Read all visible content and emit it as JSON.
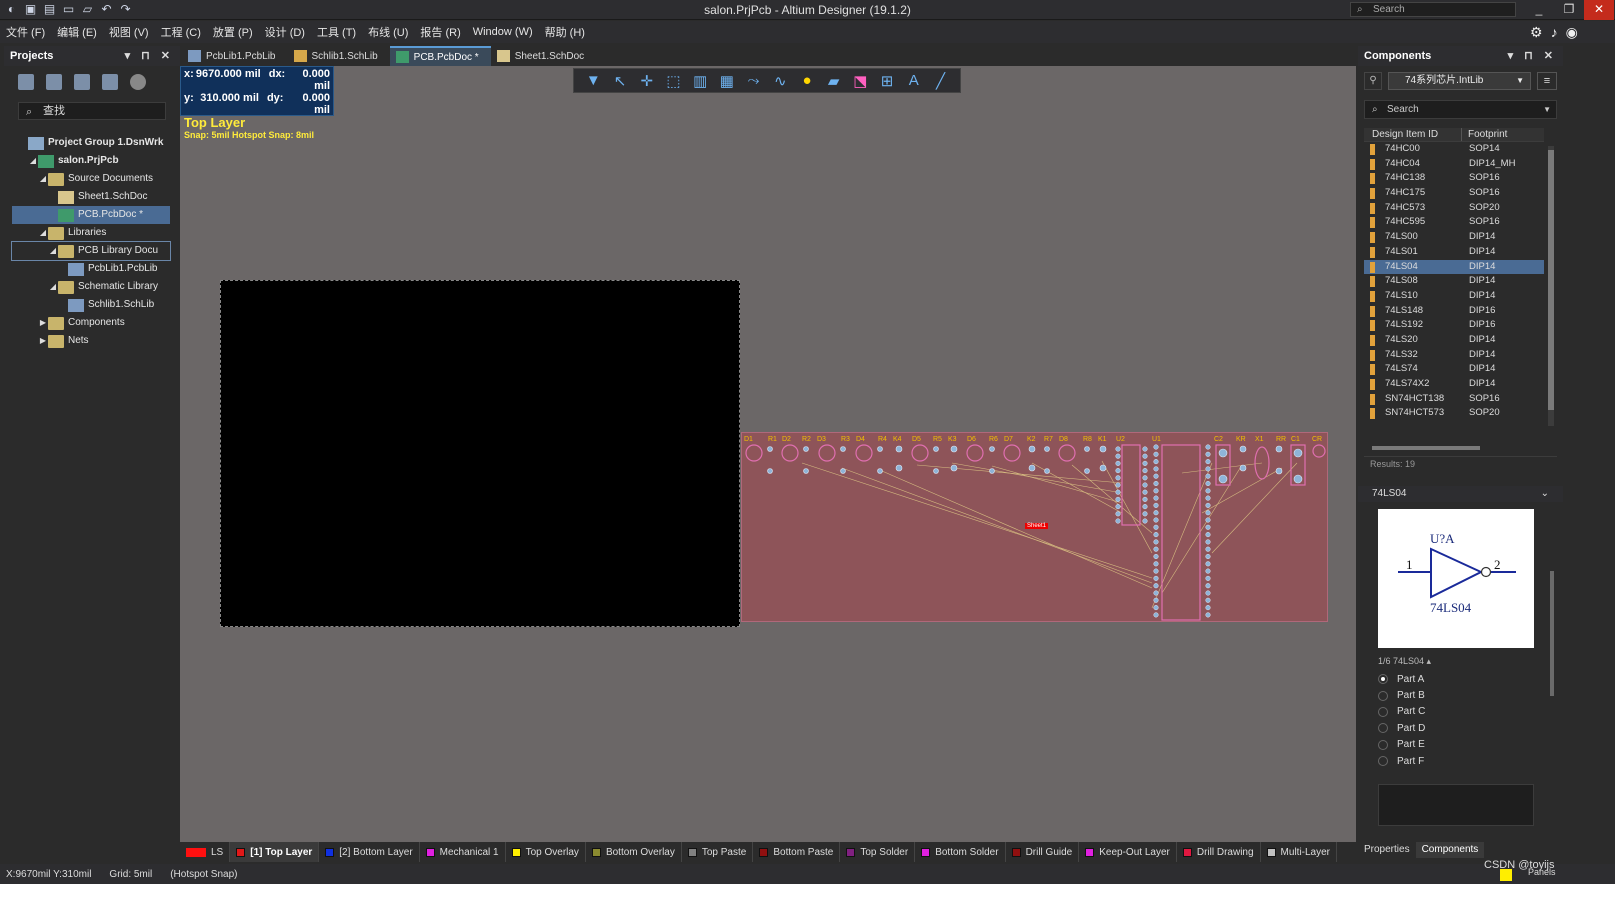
{
  "window": {
    "title": "salon.PrjPcb - Altium Designer (19.1.2)",
    "search_placeholder": "Search"
  },
  "menu": [
    "文件 (F)",
    "编辑 (E)",
    "视图 (V)",
    "工程 (C)",
    "放置 (P)",
    "设计 (D)",
    "工具 (T)",
    "布线 (U)",
    "报告 (R)",
    "Window (W)",
    "帮助 (H)"
  ],
  "projects": {
    "title": "Projects",
    "search_placeholder": "查找",
    "tree": [
      {
        "label": "Project Group 1.DsnWrk",
        "level": 0,
        "icon": "project-group-icon",
        "bold": true
      },
      {
        "label": "salon.PrjPcb",
        "level": 1,
        "icon": "project-icon",
        "bold": true
      },
      {
        "label": "Source Documents",
        "level": 2,
        "icon": "folder-icon"
      },
      {
        "label": "Sheet1.SchDoc",
        "level": 3,
        "icon": "schdoc-icon"
      },
      {
        "label": "PCB.PcbDoc *",
        "level": 3,
        "icon": "pcbdoc-icon",
        "selected": true
      },
      {
        "label": "Libraries",
        "level": 2,
        "icon": "folder-icon"
      },
      {
        "label": "PCB Library Docu",
        "level": 3,
        "icon": "folder-icon",
        "bordered": true
      },
      {
        "label": "PcbLib1.PcbLib",
        "level": 4,
        "icon": "pcblib-icon"
      },
      {
        "label": "Schematic Library",
        "level": 3,
        "icon": "folder-icon"
      },
      {
        "label": "Schlib1.SchLib",
        "level": 4,
        "icon": "schlib-icon"
      },
      {
        "label": "Components",
        "level": 2,
        "icon": "folder-icon",
        "collapsed": true
      },
      {
        "label": "Nets",
        "level": 2,
        "icon": "folder-icon",
        "collapsed": true
      }
    ]
  },
  "tabs": [
    {
      "label": "PcbLib1.PcbLib",
      "active": false,
      "color": "#7d9ac0"
    },
    {
      "label": "Schlib1.SchLib",
      "active": false,
      "color": "#d6a84a"
    },
    {
      "label": "PCB.PcbDoc *",
      "active": true,
      "color": "#3f9a6b"
    },
    {
      "label": "Sheet1.SchDoc",
      "active": false,
      "color": "#d8c68d"
    }
  ],
  "coords": {
    "x": "9670.000",
    "dx": "0.000 mil",
    "y": "310.000",
    "dy": "0.000 mil",
    "x_label": "x:",
    "y_label": "y:",
    "dx_label": "dx:",
    "dy_label": "dy:",
    "x_unit": "mil",
    "y_unit": "mil",
    "layer": "Top Layer",
    "snap": "Snap: 5mil Hotspot Snap: 8mil"
  },
  "pcb": {
    "sheet_label": "Sheet1"
  },
  "components": {
    "title": "Components",
    "library": "74系列芯片.IntLib",
    "search_placeholder": "Search",
    "col_id": "Design Item ID",
    "col_fp": "Footprint",
    "rows": [
      [
        "74HC00",
        "SOP14"
      ],
      [
        "74HC04",
        "DIP14_MH"
      ],
      [
        "74HC138",
        "SOP16"
      ],
      [
        "74HC175",
        "SOP16"
      ],
      [
        "74HC573",
        "SOP20"
      ],
      [
        "74HC595",
        "SOP16"
      ],
      [
        "74LS00",
        "DIP14"
      ],
      [
        "74LS01",
        "DIP14"
      ],
      [
        "74LS04",
        "DIP14"
      ],
      [
        "74LS08",
        "DIP14"
      ],
      [
        "74LS10",
        "DIP14"
      ],
      [
        "74LS148",
        "DIP16"
      ],
      [
        "74LS192",
        "DIP16"
      ],
      [
        "74LS20",
        "DIP14"
      ],
      [
        "74LS32",
        "DIP14"
      ],
      [
        "74LS74",
        "DIP14"
      ],
      [
        "74LS74X2",
        "DIP14"
      ],
      [
        "SN74HCT138",
        "SOP16"
      ],
      [
        "SN74HCT573",
        "SOP20"
      ]
    ],
    "selected_index": 8,
    "results": "Results: 19",
    "detail_name": "74LS04",
    "designator": "U?A",
    "comment": "74LS04",
    "pin_in": "1",
    "pin_out": "2",
    "part_selector": "1/6  74LS04 ▴",
    "parts": [
      "Part A",
      "Part B",
      "Part C",
      "Part D",
      "Part E",
      "Part F"
    ],
    "bottom_tabs": [
      "Properties",
      "Components"
    ]
  },
  "layers": [
    {
      "label": "LS",
      "color": "#ff1010",
      "special": true
    },
    {
      "label": "[1] Top Layer",
      "color": "#e01818",
      "active": true
    },
    {
      "label": "[2] Bottom Layer",
      "color": "#1030e0"
    },
    {
      "label": "Mechanical 1",
      "color": "#e020e0"
    },
    {
      "label": "Top Overlay",
      "color": "#ffee00"
    },
    {
      "label": "Bottom Overlay",
      "color": "#8a8a30"
    },
    {
      "label": "Top Paste",
      "color": "#808080"
    },
    {
      "label": "Bottom Paste",
      "color": "#901010"
    },
    {
      "label": "Top Solder",
      "color": "#802080"
    },
    {
      "label": "Bottom Solder",
      "color": "#e020e0"
    },
    {
      "label": "Drill Guide",
      "color": "#901010"
    },
    {
      "label": "Keep-Out Layer",
      "color": "#e020e0"
    },
    {
      "label": "Drill Drawing",
      "color": "#e01840"
    },
    {
      "label": "Multi-Layer",
      "color": "#c0c0c0"
    }
  ],
  "status": {
    "pos": "X:9670mil Y:310mil",
    "grid": "Grid: 5mil",
    "snap": "(Hotspot Snap)",
    "watermark": "CSDN @toyijs",
    "panels": "Panels"
  }
}
